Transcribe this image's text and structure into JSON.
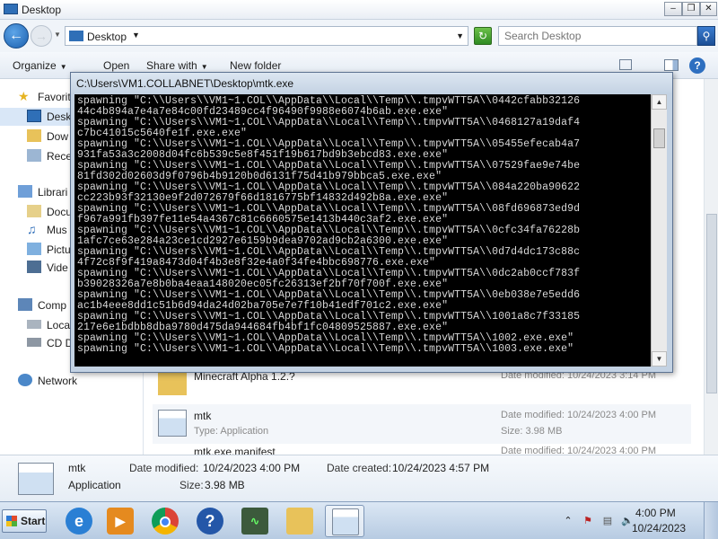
{
  "explorer": {
    "window_title": "Desktop",
    "address": "Desktop",
    "search_placeholder": "Search Desktop",
    "toolbar": {
      "organize": "Organize",
      "open": "Open",
      "share_with": "Share with",
      "new_folder": "New folder"
    },
    "nav": {
      "favorites": "Favorit",
      "desktop": "Desk",
      "downloads": "Dow",
      "recent": "Rece",
      "libraries": "Librari",
      "documents": "Docu",
      "music": "Mus",
      "pictures": "Pictu",
      "videos": "Vide",
      "computer": "Comp",
      "local_disk": "Loca",
      "cd_drive": "CD D",
      "network": "Network"
    },
    "files": [
      {
        "name": "Minecraft Alpha 1.2.?",
        "type": "",
        "date": "Date modified: 10/24/2023 3:14 PM",
        "size": ""
      },
      {
        "name": "mtk",
        "type": "Type: Application",
        "date": "Date modified: 10/24/2023 4:00 PM",
        "size": "Size: 3.98 MB"
      },
      {
        "name": "mtk.exe.manifest",
        "type": "",
        "date": "Date modified: 10/24/2023 4:00 PM",
        "size": ""
      }
    ],
    "details": {
      "name": "mtk",
      "type": "Application",
      "modified_label": "Date modified:",
      "modified": "10/24/2023 4:00 PM",
      "created_label": "Date created:",
      "created": "10/24/2023 4:57 PM",
      "size_label": "Size:",
      "size": "3.98 MB"
    }
  },
  "console": {
    "title": "C:\\Users\\VM1.COLLABNET\\Desktop\\mtk.exe",
    "lines": [
      "spawning \"C:\\\\Users\\\\VM1~1.COL\\\\AppData\\\\Local\\\\Temp\\\\.tmpvWTT5A\\\\0442cfabb32126",
      "44c4b894a7e4a7e84c00fd23489cc4f96490f9988e6074b6ab.exe.exe\"",
      "spawning \"C:\\\\Users\\\\VM1~1.COL\\\\AppData\\\\Local\\\\Temp\\\\.tmpvWTT5A\\\\0468127a19daf4",
      "c7bc41015c5640fe1f.exe.exe\"",
      "spawning \"C:\\\\Users\\\\VM1~1.COL\\\\AppData\\\\Local\\\\Temp\\\\.tmpvWTT5A\\\\05455efecab4a7",
      "931fa53a3c2008d04fc6b539c5e8f451f19b617bd9b3ebcd83.exe.exe\"",
      "spawning \"C:\\\\Users\\\\VM1~1.COL\\\\AppData\\\\Local\\\\Temp\\\\.tmpvWTT5A\\\\07529fae9e74be",
      "81fd302d02603d9f0796b4b9120b0d6131f75d41b979bbca5.exe.exe\"",
      "spawning \"C:\\\\Users\\\\VM1~1.COL\\\\AppData\\\\Local\\\\Temp\\\\.tmpvWTT5A\\\\084a220ba90622",
      "cc223b93f32130e9f2d072679f66d1816775bf14832d492b8a.exe.exe\"",
      "spawning \"C:\\\\Users\\\\VM1~1.COL\\\\AppData\\\\Local\\\\Temp\\\\.tmpvWTT5A\\\\08fd696873ed9d",
      "f967a991fb397fe11e54a4367c81c6660575e1413b440c3af2.exe.exe\"",
      "spawning \"C:\\\\Users\\\\VM1~1.COL\\\\AppData\\\\Local\\\\Temp\\\\.tmpvWTT5A\\\\0cfc34fa76228b",
      "1afc7ce63e284a23ce1cd2927e6159b9dea9702ad9cb2a6300.exe.exe\"",
      "spawning \"C:\\\\Users\\\\VM1~1.COL\\\\AppData\\\\Local\\\\Temp\\\\.tmpvWTT5A\\\\0d7d4dc173c88c",
      "4f72c8f9f419a8473d04f4b3e8f32e4a0f34fe4bbc698776.exe.exe\"",
      "spawning \"C:\\\\Users\\\\VM1~1.COL\\\\AppData\\\\Local\\\\Temp\\\\.tmpvWTT5A\\\\0dc2ab0ccf783f",
      "b39028326a7e8b0ba4eaa148020ec05fc26313ef2bf70f700f.exe.exe\"",
      "spawning \"C:\\\\Users\\\\VM1~1.COL\\\\AppData\\\\Local\\\\Temp\\\\.tmpvWTT5A\\\\0eb038e7e5edd6",
      "ac1b4eee8dd1c51b6d94da24d02ba705e7e7f10b41edf701c2.exe.exe\"",
      "spawning \"C:\\\\Users\\\\VM1~1.COL\\\\AppData\\\\Local\\\\Temp\\\\.tmpvWTT5A\\\\1001a8c7f33185",
      "217e6e1bdbb8dba9780d475da944684fb4bf1fc04809525887.exe.exe\"",
      "spawning \"C:\\\\Users\\\\VM1~1.COL\\\\AppData\\\\Local\\\\Temp\\\\.tmpvWTT5A\\\\1002.exe.exe\"",
      "spawning \"C:\\\\Users\\\\VM1~1.COL\\\\AppData\\\\Local\\\\Temp\\\\.tmpvWTT5A\\\\1003.exe.exe\""
    ]
  },
  "taskbar": {
    "start_label": "Start",
    "clock_time": "4:00 PM",
    "clock_date": "10/24/2023",
    "apps": [
      "internet-explorer",
      "media-player",
      "chrome",
      "help",
      "task-manager",
      "explorer",
      "mtk-app"
    ]
  }
}
